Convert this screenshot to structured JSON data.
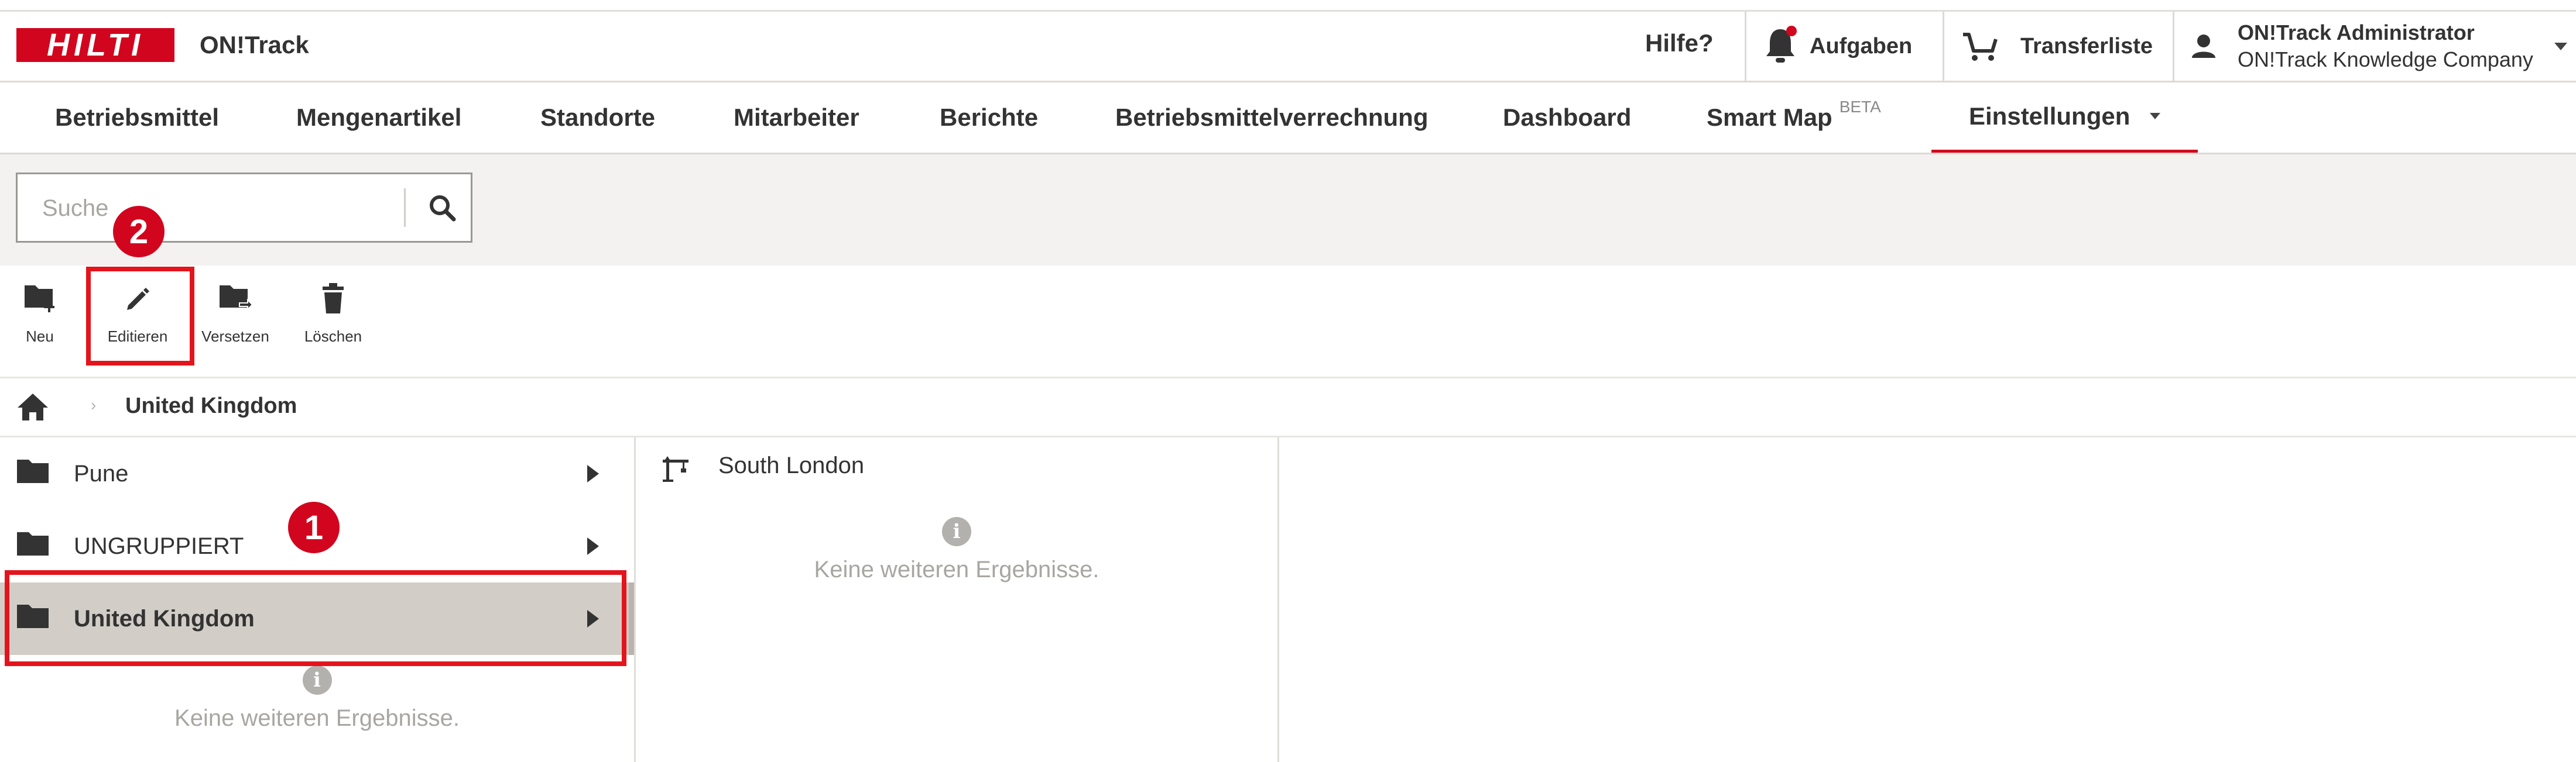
{
  "app": {
    "brand_logo_text": "HILTI",
    "name": "ON!Track"
  },
  "header": {
    "help": "Hilfe?",
    "tasks_label": "Aufgaben",
    "tasks_has_notification": true,
    "transfer_label": "Transferliste",
    "user_name": "ON!Track Administrator",
    "user_company": "ON!Track Knowledge Company"
  },
  "nav": {
    "items": [
      {
        "label": "Betriebsmittel"
      },
      {
        "label": "Mengenartikel"
      },
      {
        "label": "Standorte"
      },
      {
        "label": "Mitarbeiter"
      },
      {
        "label": "Berichte"
      },
      {
        "label": "Betriebsmittelverrechnung"
      },
      {
        "label": "Dashboard"
      },
      {
        "label": "Smart Map",
        "badge": "BETA"
      },
      {
        "label": "Einstellungen",
        "active": true
      }
    ]
  },
  "search": {
    "placeholder": "Suche"
  },
  "toolbar": {
    "new_label": "Neu",
    "edit_label": "Editieren",
    "move_label": "Versetzen",
    "delete_label": "Löschen"
  },
  "breadcrumb": {
    "current": "United Kingdom"
  },
  "groups": {
    "items": [
      {
        "label": "Pune"
      },
      {
        "label": "UNGRUPPIERT"
      },
      {
        "label": "United Kingdom",
        "selected": true
      }
    ],
    "empty_text": "Keine weiteren Ergebnisse."
  },
  "locations": {
    "items": [
      {
        "label": "South London",
        "icon": "crane-icon"
      }
    ],
    "empty_text": "Keine weiteren Ergebnisse."
  },
  "annotations": {
    "marker_1": "1",
    "marker_2": "2"
  },
  "colors": {
    "brand_red": "#d2051e",
    "selection_bg": "#d2cec7",
    "search_area_bg": "#f3f2f0",
    "annotation_red": "#e4141c"
  }
}
